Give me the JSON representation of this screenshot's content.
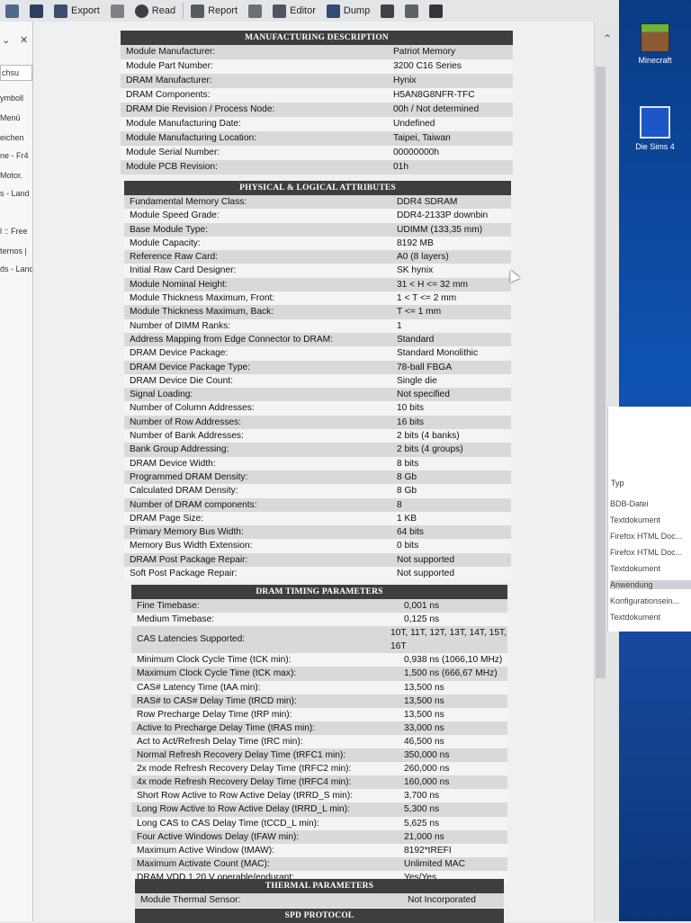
{
  "toolbar": {
    "export_label": "Export",
    "read_label": "Read",
    "report_label": "Report",
    "editor_label": "Editor",
    "dump_label": "Dump"
  },
  "left_sidebar": {
    "items": [
      "chsu",
      "ymboll",
      "Menü",
      "eichen",
      "ne - Fr4",
      "Motor.",
      "s - Land",
      "l :: Free",
      "ternos |",
      "ds - Land"
    ]
  },
  "desktop": {
    "icons": [
      {
        "name": "Minecraft"
      },
      {
        "name": "Die Sims 4"
      }
    ]
  },
  "explorer": {
    "column_header": "Typ",
    "rows": [
      "BDB-Datei",
      "Textdokument",
      "Firefox HTML Doc...",
      "Firefox HTML Doc...",
      "Textdokument",
      "Anwendung",
      "Konfigurationsein...",
      "Textdokument"
    ],
    "selected_index": 5
  },
  "report": {
    "sections": [
      {
        "title": "MANUFACTURING DESCRIPTION",
        "rows": [
          [
            "Module Manufacturer:",
            "Patriot Memory"
          ],
          [
            "Module Part Number:",
            "3200 C16 Series"
          ],
          [
            "DRAM Manufacturer:",
            "Hynix"
          ],
          [
            "DRAM Components:",
            "H5AN8G8NFR-TFC"
          ],
          [
            "DRAM Die Revision / Process Node:",
            "00h / Not determined"
          ],
          [
            "Module Manufacturing Date:",
            "Undefined"
          ],
          [
            "Module Manufacturing Location:",
            "Taipei, Taiwan"
          ],
          [
            "Module Serial Number:",
            "00000000h"
          ],
          [
            "Module PCB Revision:",
            "01h"
          ]
        ]
      },
      {
        "title": "PHYSICAL & LOGICAL ATTRIBUTES",
        "rows": [
          [
            "Fundamental Memory Class:",
            "DDR4 SDRAM"
          ],
          [
            "Module Speed Grade:",
            "DDR4-2133P downbin"
          ],
          [
            "Base Module Type:",
            "UDIMM (133,35 mm)"
          ],
          [
            "Module Capacity:",
            "8192 MB"
          ],
          [
            "Reference Raw Card:",
            "A0 (8 layers)"
          ],
          [
            "Initial Raw Card Designer:",
            "SK hynix"
          ],
          [
            "Module Nominal Height:",
            "31 < H <= 32 mm"
          ],
          [
            "Module Thickness Maximum, Front:",
            "1 < T <= 2 mm"
          ],
          [
            "Module Thickness Maximum, Back:",
            "T <= 1 mm"
          ],
          [
            "Number of DIMM Ranks:",
            "1"
          ],
          [
            "Address Mapping from Edge Connector to DRAM:",
            "Standard"
          ],
          [
            "DRAM Device Package:",
            "Standard Monolithic"
          ],
          [
            "DRAM Device Package Type:",
            "78-ball FBGA"
          ],
          [
            "DRAM Device Die Count:",
            "Single die"
          ],
          [
            "Signal Loading:",
            "Not specified"
          ],
          [
            "Number of Column Addresses:",
            "10 bits"
          ],
          [
            "Number of Row Addresses:",
            "16 bits"
          ],
          [
            "Number of Bank Addresses:",
            "2 bits (4 banks)"
          ],
          [
            "Bank Group Addressing:",
            "2 bits (4 groups)"
          ],
          [
            "DRAM Device Width:",
            "8 bits"
          ],
          [
            "Programmed DRAM Density:",
            "8 Gb"
          ],
          [
            "Calculated DRAM Density:",
            "8 Gb"
          ],
          [
            "Number of DRAM components:",
            "8"
          ],
          [
            "DRAM Page Size:",
            "1 KB"
          ],
          [
            "Primary Memory Bus Width:",
            "64 bits"
          ],
          [
            "Memory Bus Width Extension:",
            "0 bits"
          ],
          [
            "DRAM Post Package Repair:",
            "Not supported"
          ],
          [
            "Soft Post Package Repair:",
            "Not supported"
          ]
        ]
      },
      {
        "title": "DRAM TIMING PARAMETERS",
        "rows": [
          [
            "Fine Timebase:",
            "0,001 ns"
          ],
          [
            "Medium Timebase:",
            "0,125 ns"
          ],
          [
            "CAS Latencies Supported:",
            "10T, 11T, 12T, 13T, 14T, 15T, 16T"
          ],
          [
            "Minimum Clock Cycle Time (tCK min):",
            "0,938 ns (1066,10 MHz)"
          ],
          [
            "Maximum Clock Cycle Time (tCK max):",
            "1,500 ns (666,67 MHz)"
          ],
          [
            "CAS# Latency Time (tAA min):",
            "13,500 ns"
          ],
          [
            "RAS# to CAS# Delay Time (tRCD min):",
            "13,500 ns"
          ],
          [
            "Row Precharge Delay Time (tRP min):",
            "13,500 ns"
          ],
          [
            "Active to Precharge Delay Time (tRAS min):",
            "33,000 ns"
          ],
          [
            "Act to Act/Refresh Delay Time (tRC min):",
            "46,500 ns"
          ],
          [
            "Normal Refresh Recovery Delay Time (tRFC1 min):",
            "350,000 ns"
          ],
          [
            "2x mode Refresh Recovery Delay Time (tRFC2 min):",
            "260,000 ns"
          ],
          [
            "4x mode Refresh Recovery Delay Time (tRFC4 min):",
            "160,000 ns"
          ],
          [
            "Short Row Active to Row Active Delay (tRRD_S min):",
            "3,700 ns"
          ],
          [
            "Long Row Active to Row Active Delay (tRRD_L min):",
            "5,300 ns"
          ],
          [
            "Long CAS to CAS Delay Time (tCCD_L min):",
            "5,625 ns"
          ],
          [
            "Four Active Windows Delay (tFAW min):",
            "21,000 ns"
          ],
          [
            "Maximum Active Window (tMAW):",
            "8192*tREFI"
          ],
          [
            "Maximum Activate Count (MAC):",
            "Unlimited MAC"
          ],
          [
            "DRAM VDD 1,20 V operable/endurant:",
            "Yes/Yes"
          ]
        ]
      },
      {
        "title": "THERMAL PARAMETERS",
        "rows": [
          [
            "Module Thermal Sensor:",
            "Not Incorporated"
          ]
        ]
      },
      {
        "title": "SPD PROTOCOL",
        "rows": []
      }
    ]
  }
}
